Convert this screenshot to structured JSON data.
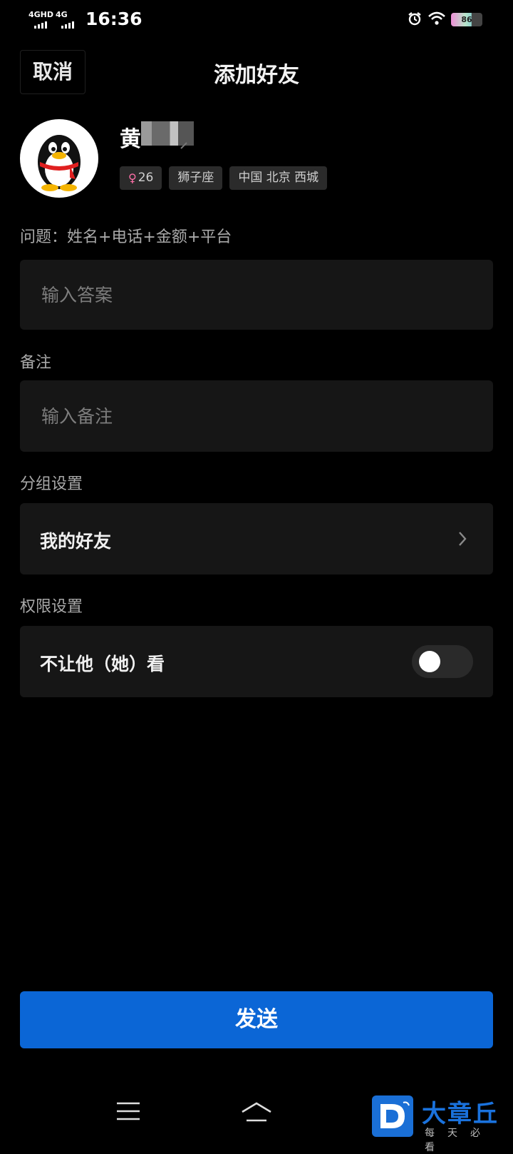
{
  "status_bar": {
    "network1": "4GHD",
    "network2": "4G",
    "time": "16:36",
    "battery": "86"
  },
  "header": {
    "cancel_label": "取消",
    "title": "添加好友"
  },
  "profile": {
    "name": "黄",
    "tags": {
      "age": "26",
      "zodiac": "狮子座",
      "location": "中国 北京 西城"
    }
  },
  "form": {
    "question_label": "问题：姓名+电话+金额+平台",
    "answer_placeholder": "输入答案",
    "remark_label": "备注",
    "remark_placeholder": "输入备注",
    "group_label": "分组设置",
    "group_value": "我的好友",
    "permission_label": "权限设置",
    "permission_option": "不让他（她）看",
    "permission_enabled": false
  },
  "send_label": "发送",
  "watermark": {
    "title": "大章丘",
    "subtitle": "每天必看"
  },
  "colors": {
    "background": "#000000",
    "field_background": "#161616",
    "primary": "#0b66d6",
    "female": "#ff6fa8"
  }
}
